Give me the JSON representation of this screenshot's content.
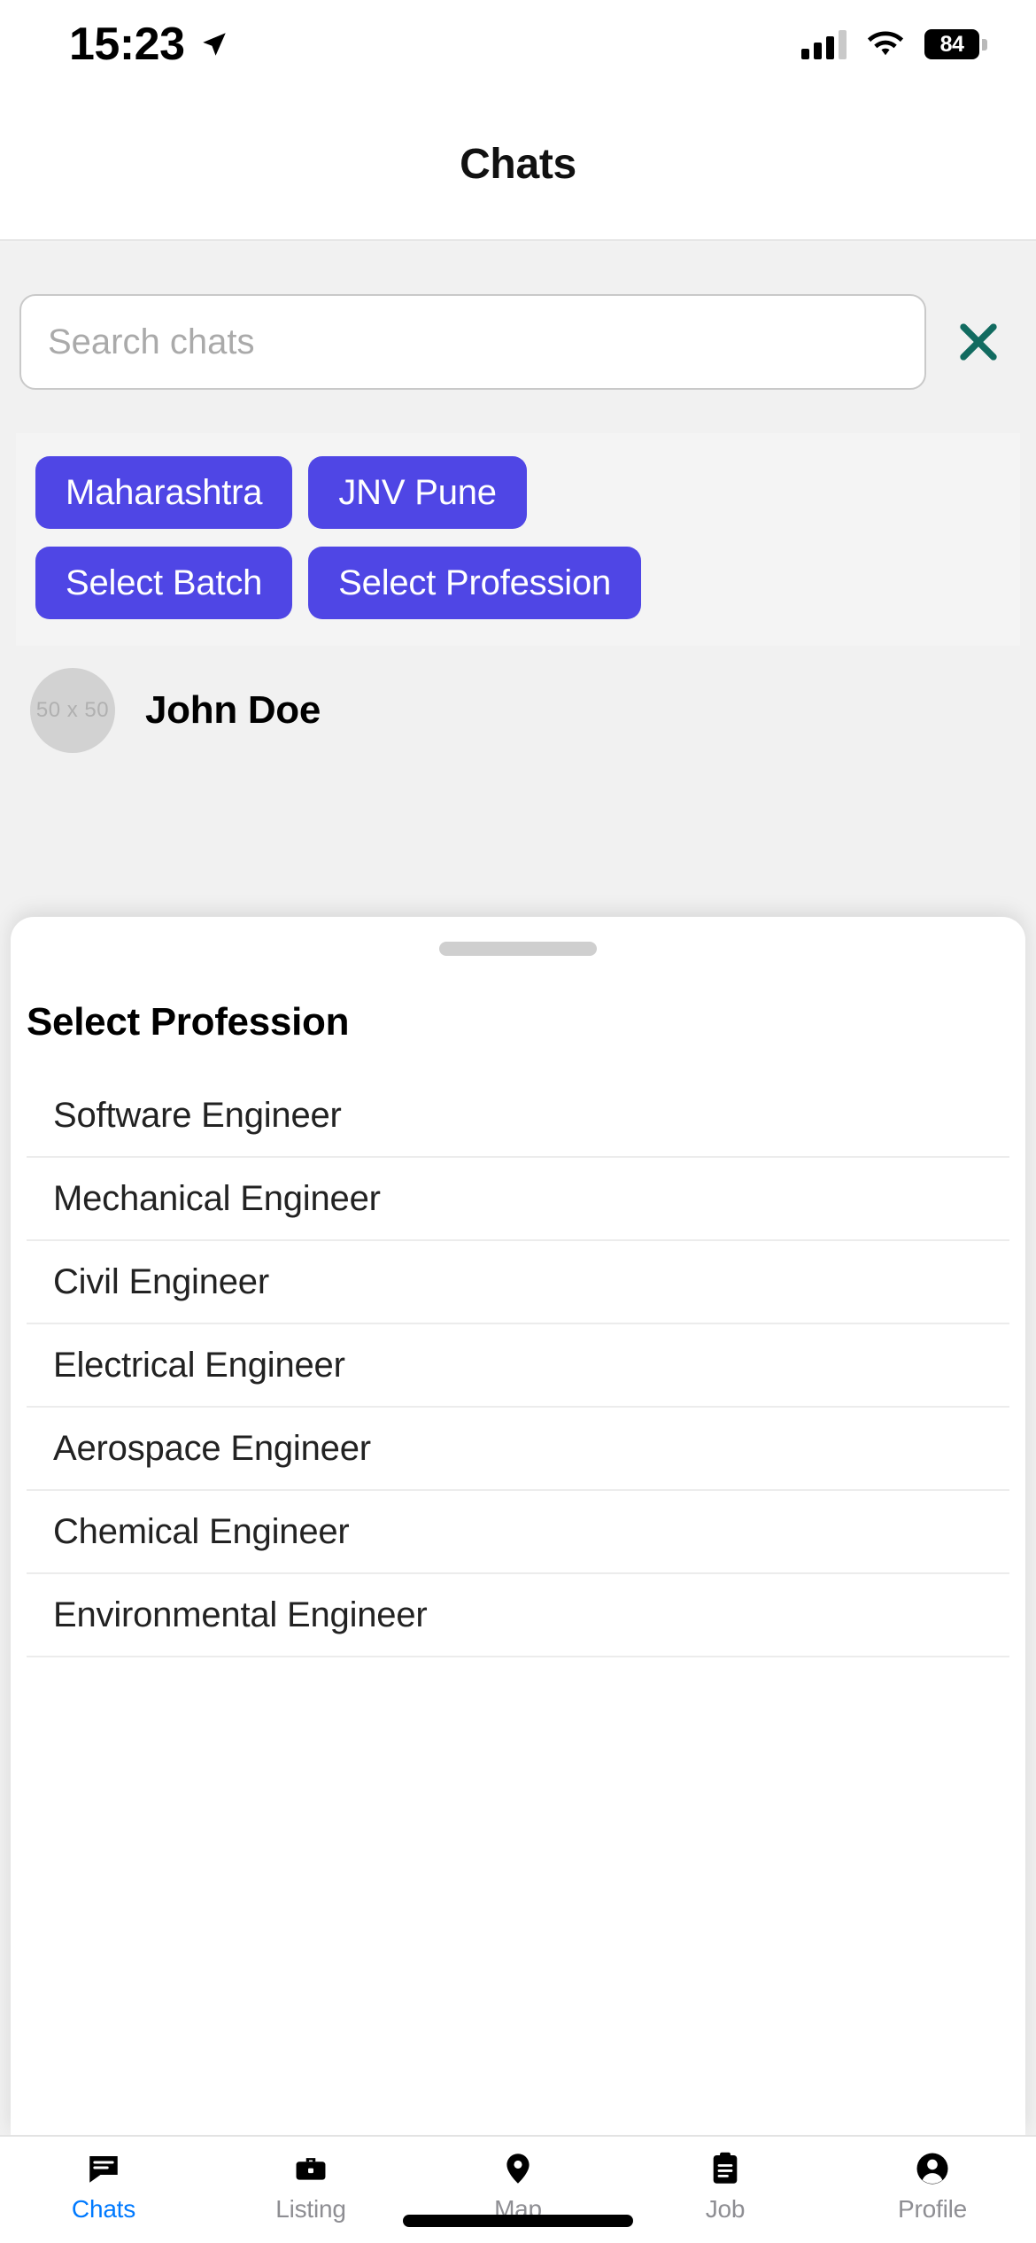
{
  "status_bar": {
    "time": "15:23",
    "location_icon": "location-arrow-icon",
    "signal_icon": "cellular-signal-icon",
    "wifi_icon": "wifi-icon",
    "battery_percent": "84"
  },
  "header": {
    "title": "Chats"
  },
  "search": {
    "placeholder": "Search chats",
    "value": "",
    "clear_icon": "close-x-icon",
    "clear_color": "#126b60"
  },
  "filters": {
    "accent_color": "#4f46e5",
    "rows": [
      [
        "Maharashtra",
        "JNV Pune"
      ],
      [
        "Select Batch",
        "Select Profession"
      ]
    ]
  },
  "contacts": [
    {
      "avatar_label": "50 x 50",
      "name": "John Doe"
    }
  ],
  "sheet": {
    "title": "Select Profession",
    "handle": "drag-handle",
    "options": [
      "Software Engineer",
      "Mechanical Engineer",
      "Civil Engineer",
      "Electrical Engineer",
      "Aerospace Engineer",
      "Chemical Engineer",
      "Environmental Engineer"
    ]
  },
  "tab_bar": {
    "active_color": "#007aff",
    "inactive_color": "#8e8e93",
    "tabs": [
      {
        "label": "Chats",
        "icon": "chat-bubble-icon",
        "active": true
      },
      {
        "label": "Listing",
        "icon": "briefcase-icon",
        "active": false
      },
      {
        "label": "Map",
        "icon": "map-pin-icon",
        "active": false
      },
      {
        "label": "Job",
        "icon": "clipboard-icon",
        "active": false
      },
      {
        "label": "Profile",
        "icon": "person-circle-icon",
        "active": false
      }
    ]
  }
}
